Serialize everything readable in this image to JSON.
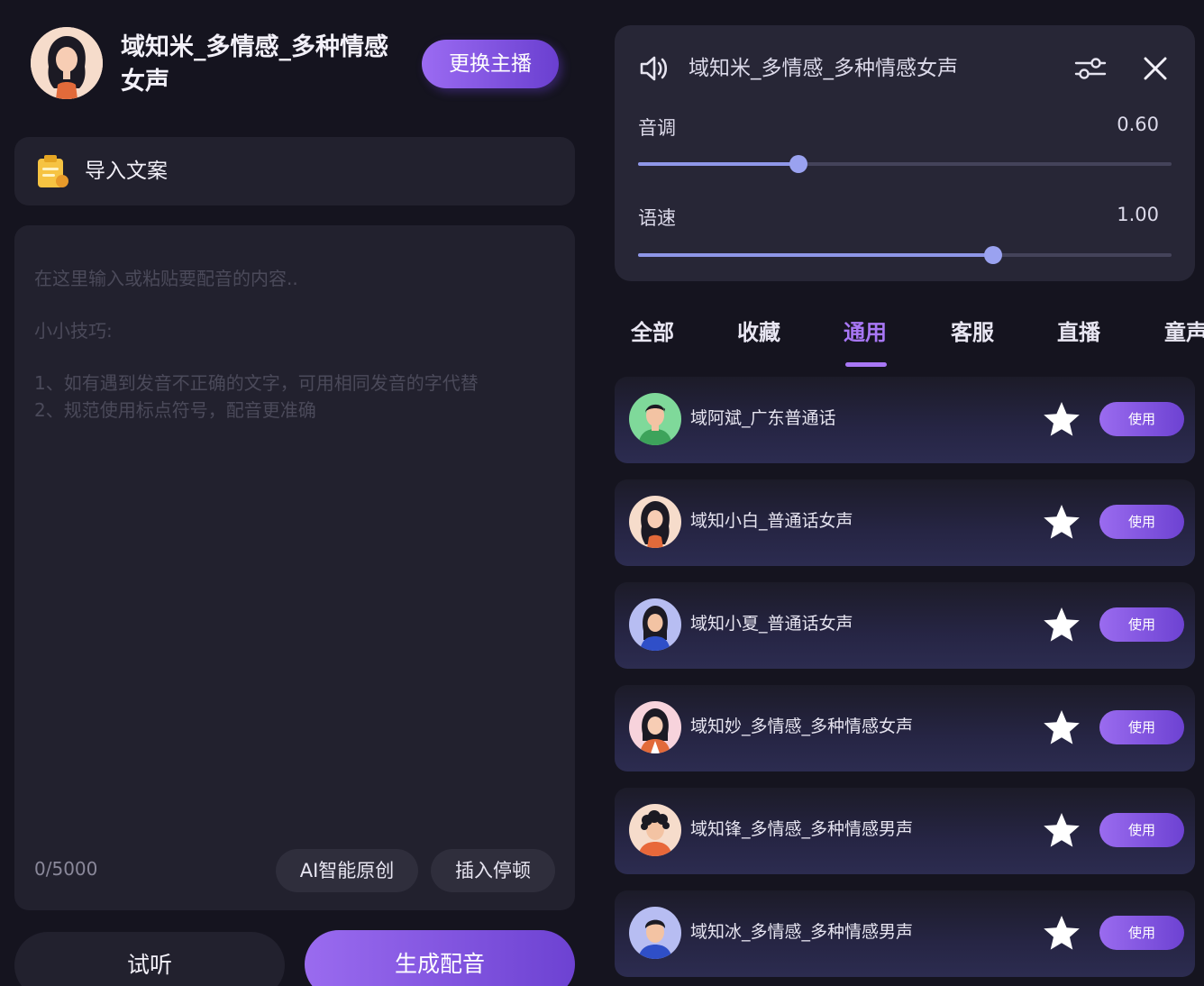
{
  "host": {
    "name": "域知米_多情感_多种情感女声",
    "change_button": "更换主播"
  },
  "import": {
    "label": "导入文案"
  },
  "editor": {
    "placeholder_line": "在这里输入或粘贴要配音的内容..",
    "tips_heading": "小小技巧:",
    "tip_1": "1、如有遇到发音不正确的文字，可用相同发音的字代替",
    "tip_2": "2、规范使用标点符号，配音更准确",
    "char_count": "0/5000",
    "ai_button": "AI智能原创",
    "pause_button": "插入停顿"
  },
  "actions": {
    "listen": "试听",
    "generate": "生成配音"
  },
  "settings": {
    "voice_title": "域知米_多情感_多种情感女声",
    "pitch_label": "音调",
    "pitch_value": "0.60",
    "pitch_level": 0.3,
    "speed_label": "语速",
    "speed_value": "1.00",
    "speed_level": 0.665
  },
  "tabs": [
    {
      "label": "全部"
    },
    {
      "label": "收藏"
    },
    {
      "label": "通用"
    },
    {
      "label": "客服"
    },
    {
      "label": "直播"
    },
    {
      "label": "童声"
    }
  ],
  "active_tab": "通用",
  "voices": [
    {
      "name": "域阿斌_广东普通话",
      "use": "使用",
      "avatar": "male-green-avatar"
    },
    {
      "name": "域知小白_普通话女声",
      "use": "使用",
      "avatar": "female-long-hair-avatar"
    },
    {
      "name": "域知小夏_普通话女声",
      "use": "使用",
      "avatar": "female-blue-avatar"
    },
    {
      "name": "域知妙_多情感_多种情感女声",
      "use": "使用",
      "avatar": "female-pink-avatar"
    },
    {
      "name": "域知锋_多情感_多种情感男声",
      "use": "使用",
      "avatar": "male-curly-avatar"
    },
    {
      "name": "域知冰_多情感_多种情感男声",
      "use": "使用",
      "avatar": "male-blue-avatar"
    }
  ],
  "colors": {
    "accent": "#a877f5",
    "button_gradient_start": "#9a6bef",
    "button_gradient_end": "#6d42d2",
    "background": "#15141f",
    "panel": "#22212e"
  }
}
